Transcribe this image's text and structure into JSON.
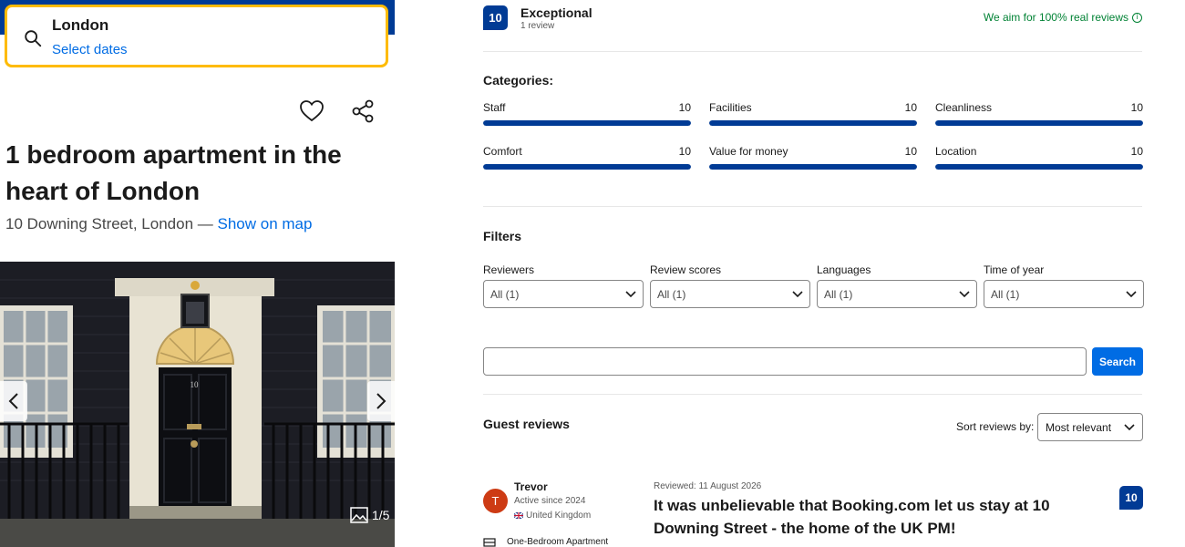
{
  "search": {
    "destination": "London",
    "dates_placeholder": "Select dates"
  },
  "property": {
    "title": "1 bedroom apartment in the heart of London",
    "address": "10 Downing Street, London —",
    "map_link": "Show on map",
    "photo_counter": "1/5",
    "door_number": "10"
  },
  "reviews": {
    "score": "10",
    "score_word": "Exceptional",
    "review_count": "1 review",
    "real_reviews_note": "We aim for 100% real reviews",
    "categories_title": "Categories:",
    "categories": [
      {
        "name": "Staff",
        "score": "10",
        "fill": 1.0
      },
      {
        "name": "Facilities",
        "score": "10",
        "fill": 1.0
      },
      {
        "name": "Cleanliness",
        "score": "10",
        "fill": 1.0
      },
      {
        "name": "Comfort",
        "score": "10",
        "fill": 1.0
      },
      {
        "name": "Value for money",
        "score": "10",
        "fill": 1.0
      },
      {
        "name": "Location",
        "score": "10",
        "fill": 1.0
      }
    ],
    "filters_title": "Filters",
    "filters": [
      {
        "label": "Reviewers",
        "value": "All (1)"
      },
      {
        "label": "Review scores",
        "value": "All (1)"
      },
      {
        "label": "Languages",
        "value": "All (1)"
      },
      {
        "label": "Time of year",
        "value": "All (1)"
      }
    ],
    "search_button": "Search",
    "guest_reviews_title": "Guest reviews",
    "sort_label": "Sort reviews by:",
    "sort_value": "Most relevant",
    "review": {
      "initial": "T",
      "name": "Trevor",
      "active_since": "Active since 2024",
      "country": "United Kingdom",
      "room": "One-Bedroom Apartment",
      "reviewed_date": "Reviewed: 11 August 2026",
      "title": "It was unbelievable that Booking.com let us stay at 10 Downing Street - the home of the UK PM!",
      "score": "10"
    }
  },
  "colors": {
    "brand_blue": "#003b95",
    "link_blue": "#006ce4",
    "highlight_yellow": "#febb02",
    "green": "#008234",
    "avatar_red": "#cd3b14"
  }
}
